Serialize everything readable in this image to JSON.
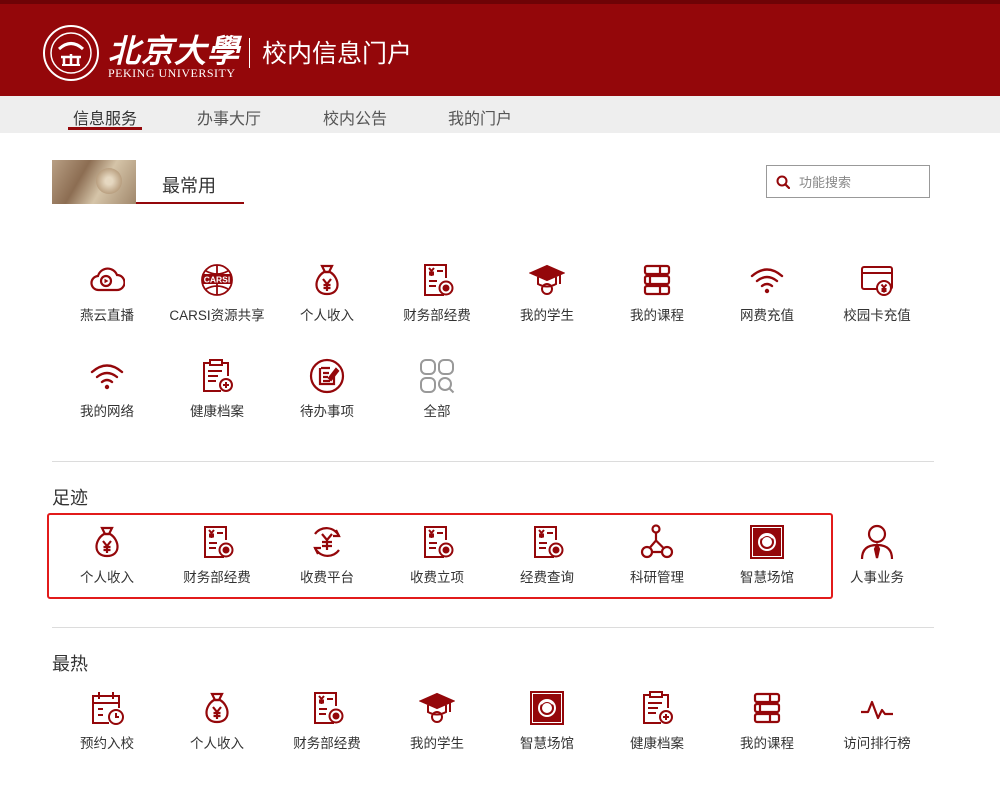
{
  "header": {
    "logo_cn": "北京大學",
    "logo_en": "PEKING UNIVERSITY",
    "title": "校内信息门户",
    "brand_color": "#94070a"
  },
  "nav": {
    "items": [
      {
        "label": "信息服务",
        "active": true
      },
      {
        "label": "办事大厅",
        "active": false
      },
      {
        "label": "校内公告",
        "active": false
      },
      {
        "label": "我的门户",
        "active": false
      }
    ]
  },
  "frequent": {
    "title": "最常用",
    "items": [
      {
        "label": "燕云直播",
        "icon": "cloud-play-icon"
      },
      {
        "label": "CARSI资源共享",
        "icon": "carsi-globe-icon"
      },
      {
        "label": "个人收入",
        "icon": "money-bag-icon"
      },
      {
        "label": "财务部经费",
        "icon": "finance-document-icon"
      },
      {
        "label": "我的学生",
        "icon": "graduation-cap-icon"
      },
      {
        "label": "我的课程",
        "icon": "books-icon"
      },
      {
        "label": "网费充值",
        "icon": "wifi-icon"
      },
      {
        "label": "校园卡充值",
        "icon": "card-yuan-icon"
      },
      {
        "label": "我的网络",
        "icon": "wifi-icon"
      },
      {
        "label": "健康档案",
        "icon": "clipboard-plus-icon"
      },
      {
        "label": "待办事项",
        "icon": "todo-edit-icon"
      },
      {
        "label": "全部",
        "icon": "grid-search-icon"
      }
    ]
  },
  "search": {
    "placeholder": "功能搜索"
  },
  "footprint": {
    "title": "足迹",
    "items": [
      {
        "label": "个人收入",
        "icon": "money-bag-icon"
      },
      {
        "label": "财务部经费",
        "icon": "finance-document-icon"
      },
      {
        "label": "收费平台",
        "icon": "yuan-cycle-icon"
      },
      {
        "label": "收费立项",
        "icon": "finance-document-icon"
      },
      {
        "label": "经费查询",
        "icon": "finance-document-icon"
      },
      {
        "label": "科研管理",
        "icon": "molecule-icon"
      },
      {
        "label": "智慧场馆",
        "icon": "venue-icon"
      },
      {
        "label": "人事业务",
        "icon": "person-tie-icon"
      }
    ]
  },
  "hot": {
    "title": "最热",
    "items": [
      {
        "label": "预约入校",
        "icon": "calendar-clock-icon"
      },
      {
        "label": "个人收入",
        "icon": "money-bag-icon"
      },
      {
        "label": "财务部经费",
        "icon": "finance-document-icon"
      },
      {
        "label": "我的学生",
        "icon": "graduation-cap-icon"
      },
      {
        "label": "智慧场馆",
        "icon": "venue-icon"
      },
      {
        "label": "健康档案",
        "icon": "clipboard-plus-icon"
      },
      {
        "label": "我的课程",
        "icon": "books-icon"
      },
      {
        "label": "访问排行榜",
        "icon": "pulse-icon"
      }
    ]
  }
}
